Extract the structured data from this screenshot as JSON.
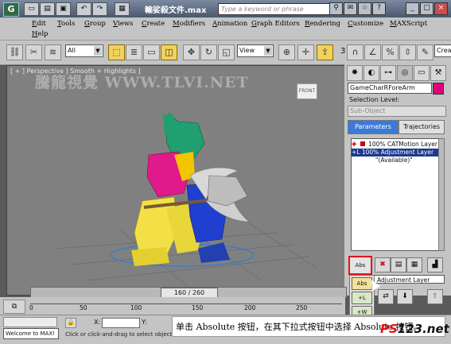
{
  "titlebar": {
    "logo": "G",
    "title": "輸娑殺文件.max",
    "search_placeholder": "Type a keyword or phrase",
    "icons": [
      "new-file-icon",
      "open-file-icon",
      "save-icon",
      "undo-icon",
      "redo-icon",
      "project-folder-icon"
    ]
  },
  "menu": {
    "row1": [
      "Edit",
      "Tools",
      "Group",
      "Views",
      "Create",
      "Modifiers",
      "Animation",
      "Graph Editors",
      "Rendering",
      "Customize",
      "MAXScript"
    ],
    "row2": [
      "Help"
    ]
  },
  "toolbar": {
    "filter_value": "All",
    "refcoord_value": "View",
    "snap_number": "3",
    "named_sel_placeholder": "Crea"
  },
  "viewport": {
    "label": "[ + ] Perspective ] Smooth + Highlights ]",
    "watermark": "騰龍視覺 WWW.TLVI.NET",
    "viewcube_label": "FRONT"
  },
  "command_panel": {
    "object_name": "GameCharRForeArm",
    "object_color": "#e2007a",
    "selection_level_label": "Selection Level:",
    "subobject_value": "Sub-Object",
    "tabs": [
      "Parameters",
      "Trajectories"
    ],
    "layers": [
      {
        "text": "100% CATMotion Layer",
        "selected": false,
        "prefix": "✚"
      },
      {
        "text": "100% Adjustment Layer",
        "selected": true,
        "prefix": "+L"
      },
      {
        "text": "\"(Available)\"",
        "selected": false,
        "prefix": ""
      }
    ],
    "abs_button_label": "Abs",
    "adjustment_field": "Adjustment Layer",
    "flyout_items": [
      "Abs",
      "+L",
      "+W"
    ]
  },
  "timeline": {
    "slider_label": "160 / 260",
    "ticks": [
      "0",
      "50",
      "100",
      "150",
      "200",
      "250"
    ]
  },
  "status": {
    "listener_text": "Welcome to MAX!",
    "prompt": "Click or click-and-drag to select objects",
    "coord_labels": [
      "X:",
      "Y:"
    ]
  },
  "caption": {
    "text": "单击 Absolute 按钮，在其下拉式按钮中选择 Absolute 按钮。",
    "logo_left": "PS",
    "logo_right": "123.net"
  }
}
